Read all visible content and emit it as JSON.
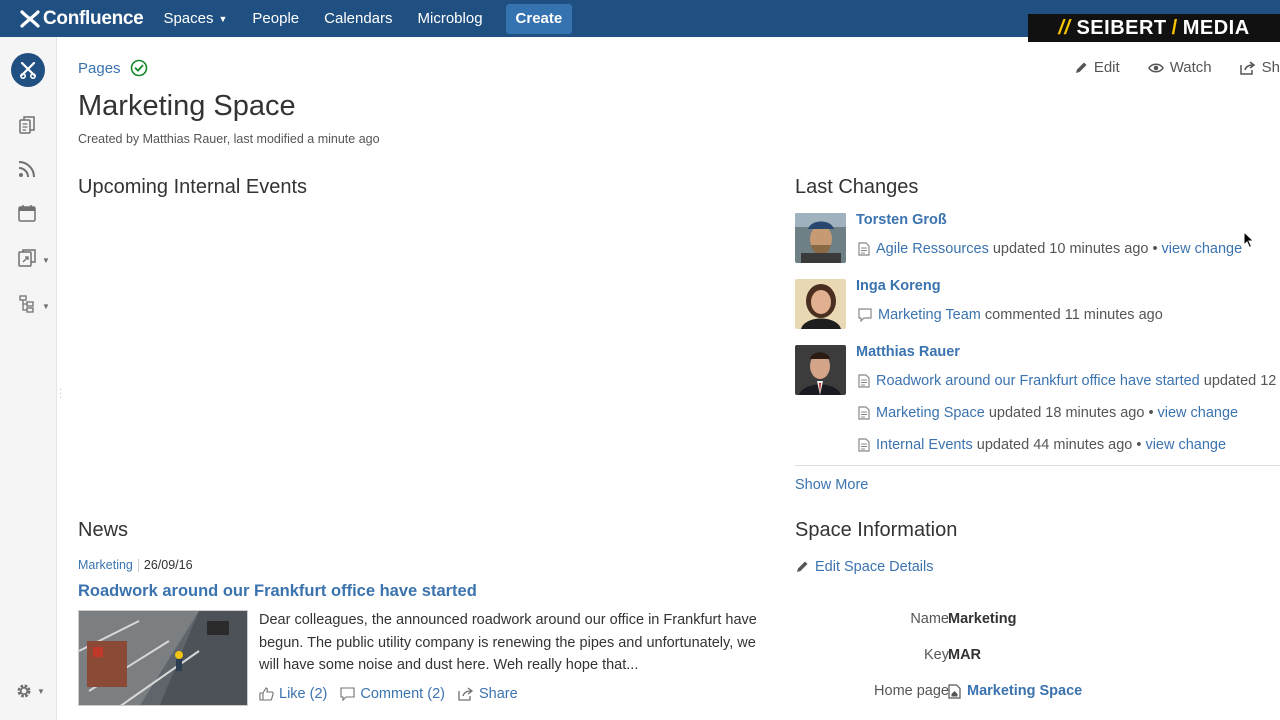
{
  "header": {
    "brand": "Confluence",
    "nav": [
      {
        "label": "Spaces",
        "has_caret": true
      },
      {
        "label": "People"
      },
      {
        "label": "Calendars"
      },
      {
        "label": "Microblog"
      }
    ],
    "create_label": "Create",
    "watermark_left": "SEIBERT",
    "watermark_right": "MEDIA",
    "brand_color": "#205081"
  },
  "sidebar": {
    "icons": [
      "space-logo-icon",
      "pages-icon",
      "rss-icon",
      "calendar-icon",
      "shortcut-icon",
      "tree-icon",
      "gear-icon"
    ]
  },
  "page": {
    "breadcrumb": "Pages",
    "title": "Marketing Space",
    "byline": "Created by Matthias Rauer, last modified a minute ago",
    "actions": {
      "edit": "Edit",
      "watch": "Watch",
      "share": "Sh"
    }
  },
  "events": {
    "heading": "Upcoming Internal Events"
  },
  "last_changes": {
    "heading": "Last Changes",
    "groups": [
      {
        "user": "Torsten Groß",
        "items": [
          {
            "icon": "page-icon",
            "title": "Agile Ressources",
            "status": "updated 10 minutes ago",
            "sep": "•",
            "link": "view change"
          }
        ]
      },
      {
        "user": "Inga Koreng",
        "items": [
          {
            "icon": "comment-icon",
            "title": "Marketing Team",
            "status": "commented 11 minutes ago"
          }
        ]
      },
      {
        "user": "Matthias Rauer",
        "items": [
          {
            "icon": "page-icon",
            "title": "Roadwork around our Frankfurt office have started",
            "status": "updated 12"
          },
          {
            "icon": "page-icon",
            "title": "Marketing Space",
            "status": "updated 18 minutes ago",
            "sep": "•",
            "link": "view change"
          },
          {
            "icon": "page-icon",
            "title": "Internal Events",
            "status": "updated 44 minutes ago",
            "sep": "•",
            "link": "view change"
          }
        ]
      }
    ],
    "show_more": "Show More"
  },
  "news": {
    "heading": "News",
    "label": "Marketing",
    "date": "26/09/16",
    "title": "Roadwork around our Frankfurt office have started",
    "excerpt": "Dear colleagues, the announced roadwork around our office in Frankfurt have begun. The public utility company is renewing the pipes and unfortunately, we will have some noise and dust here. Weh really hope that...",
    "like": "Like (2)",
    "comment": "Comment (2)",
    "share": "Share"
  },
  "space_info": {
    "heading": "Space Information",
    "edit_details": "Edit Space Details",
    "rows": [
      {
        "label": "Name",
        "value": "Marketing"
      },
      {
        "label": "Key",
        "value": "MAR"
      },
      {
        "label": "Home page",
        "value": "Marketing Space"
      }
    ]
  }
}
